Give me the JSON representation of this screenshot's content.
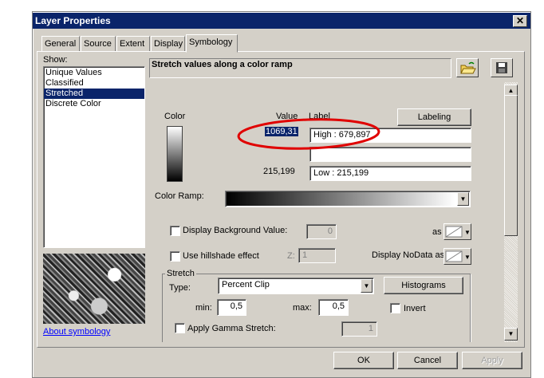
{
  "window": {
    "title": "Layer Properties",
    "close_glyph": "✕"
  },
  "tabs": [
    {
      "label": "General"
    },
    {
      "label": "Source"
    },
    {
      "label": "Extent"
    },
    {
      "label": "Display"
    },
    {
      "label": "Symbology",
      "active": true
    }
  ],
  "show": {
    "label": "Show:",
    "items": [
      "Unique Values",
      "Classified",
      "Stretched",
      "Discrete Color"
    ],
    "selected": "Stretched"
  },
  "about_link": "About symbology",
  "header": {
    "title": "Stretch values along a color ramp",
    "icons": [
      "open-folder-icon",
      "save-icon"
    ]
  },
  "ramp_table": {
    "color_label": "Color",
    "value_label": "Value",
    "label_label": "Label",
    "labeling_button": "Labeling",
    "high_value": "1069,31",
    "high_label": "High : 679,897",
    "mid_label": "",
    "low_value": "215,199",
    "low_label": "Low : 215,199"
  },
  "color_ramp": {
    "label": "Color Ramp:"
  },
  "background": {
    "label": "Display Background Value:",
    "value": "0",
    "as_label": "as",
    "checked": false
  },
  "hillshade": {
    "label": "Use hillshade effect",
    "z_label": "Z:",
    "z_value": "1",
    "checked": false
  },
  "nodata": {
    "label": "Display NoData as"
  },
  "stretch": {
    "group_label": "Stretch",
    "type_label": "Type:",
    "type_value": "Percent Clip",
    "histograms_button": "Histograms",
    "min_label": "min:",
    "min_value": "0,5",
    "max_label": "max:",
    "max_value": "0,5",
    "invert_label": "Invert",
    "invert_checked": false,
    "gamma_label": "Apply Gamma Stretch:",
    "gamma_value": "1",
    "gamma_checked": false
  },
  "footer": {
    "ok": "OK",
    "cancel": "Cancel",
    "apply": "Apply"
  },
  "colors": {
    "titlebar": "#0a246a",
    "dialog": "#d4d0c8",
    "annotation": "#e00000",
    "selection": "#0a246a"
  }
}
